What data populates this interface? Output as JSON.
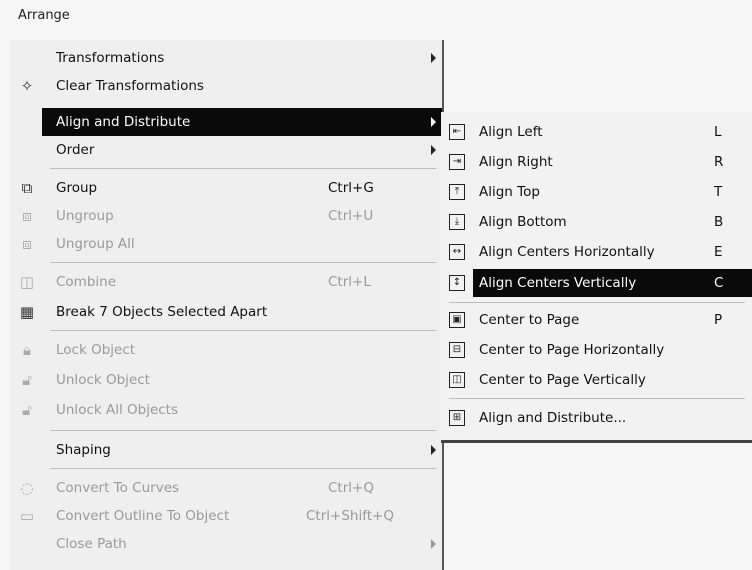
{
  "menu_title": "Arrange",
  "main_menu": {
    "items": [
      {
        "name": "transformations",
        "label": "Transformations",
        "shortcut": "",
        "icon": "",
        "submenu": true,
        "disabled": false
      },
      {
        "name": "clear-transformations",
        "label": "Clear Transformations",
        "shortcut": "",
        "icon": "clear-transform-icon",
        "submenu": false,
        "disabled": false
      },
      {
        "name": "align-and-distribute",
        "label": "Align and Distribute",
        "shortcut": "",
        "icon": "",
        "submenu": true,
        "disabled": false,
        "highlighted": true
      },
      {
        "name": "order",
        "label": "Order",
        "shortcut": "",
        "icon": "",
        "submenu": true,
        "disabled": false
      },
      {
        "name": "group",
        "label": "Group",
        "shortcut": "Ctrl+G",
        "icon": "group-icon",
        "submenu": false,
        "disabled": false
      },
      {
        "name": "ungroup",
        "label": "Ungroup",
        "shortcut": "Ctrl+U",
        "icon": "ungroup-icon",
        "submenu": false,
        "disabled": true
      },
      {
        "name": "ungroup-all",
        "label": "Ungroup All",
        "shortcut": "",
        "icon": "ungroup-all-icon",
        "submenu": false,
        "disabled": true
      },
      {
        "name": "combine",
        "label": "Combine",
        "shortcut": "Ctrl+L",
        "icon": "combine-icon",
        "submenu": false,
        "disabled": true
      },
      {
        "name": "break-apart",
        "label": "Break 7 Objects Selected Apart",
        "shortcut": "",
        "icon": "break-apart-icon",
        "submenu": false,
        "disabled": false
      },
      {
        "name": "lock-object",
        "label": "Lock Object",
        "shortcut": "",
        "icon": "lock-icon",
        "submenu": false,
        "disabled": true
      },
      {
        "name": "unlock-object",
        "label": "Unlock Object",
        "shortcut": "",
        "icon": "unlock-icon",
        "submenu": false,
        "disabled": true
      },
      {
        "name": "unlock-all-objects",
        "label": "Unlock All Objects",
        "shortcut": "",
        "icon": "unlock-all-icon",
        "submenu": false,
        "disabled": true
      },
      {
        "name": "shaping",
        "label": "Shaping",
        "shortcut": "",
        "icon": "",
        "submenu": true,
        "disabled": false
      },
      {
        "name": "convert-to-curves",
        "label": "Convert To Curves",
        "shortcut": "Ctrl+Q",
        "icon": "convert-curves-icon",
        "submenu": false,
        "disabled": true
      },
      {
        "name": "convert-outline-to-object",
        "label": "Convert Outline To Object",
        "shortcut": "Ctrl+Shift+Q",
        "icon": "outline-icon",
        "submenu": false,
        "disabled": true
      },
      {
        "name": "close-path",
        "label": "Close Path",
        "shortcut": "",
        "icon": "",
        "submenu": true,
        "disabled": true
      }
    ]
  },
  "submenu": {
    "items": [
      {
        "name": "align-left",
        "label": "Align Left",
        "key": "L",
        "icon": "align-left-icon"
      },
      {
        "name": "align-right",
        "label": "Align Right",
        "key": "R",
        "icon": "align-right-icon"
      },
      {
        "name": "align-top",
        "label": "Align Top",
        "key": "T",
        "icon": "align-top-icon"
      },
      {
        "name": "align-bottom",
        "label": "Align Bottom",
        "key": "B",
        "icon": "align-bottom-icon"
      },
      {
        "name": "align-centers-horizontally",
        "label": "Align Centers Horizontally",
        "key": "E",
        "icon": "align-centers-horizontally-icon"
      },
      {
        "name": "align-centers-vertically",
        "label": "Align Centers Vertically",
        "key": "C",
        "icon": "align-centers-vertically-icon",
        "highlighted": true
      },
      {
        "name": "center-to-page",
        "label": "Center to Page",
        "key": "P",
        "icon": "center-to-page-icon"
      },
      {
        "name": "center-to-page-horizontally",
        "label": "Center to Page Horizontally",
        "key": "",
        "icon": "center-page-horizontally-icon"
      },
      {
        "name": "center-to-page-vertically",
        "label": "Center to Page Vertically",
        "key": "",
        "icon": "center-page-vertically-icon"
      },
      {
        "name": "align-and-distribute-dialog",
        "label": "Align and Distribute...",
        "key": "",
        "icon": "align-distribute-icon"
      }
    ]
  }
}
